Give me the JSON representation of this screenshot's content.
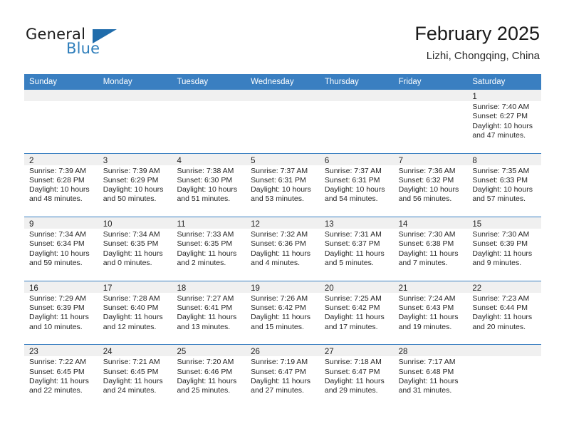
{
  "brand": {
    "name_top": "General",
    "name_bottom": "Blue",
    "flag_icon": "triangle-flag-icon",
    "accent_color": "#2e7ebb"
  },
  "header": {
    "title": "February 2025",
    "subtitle": "Lizhi, Chongqing, China"
  },
  "calendar": {
    "header_bg": "#3a7fc1",
    "header_text_color": "#ffffff",
    "datebar_bg": "#f0f0f0",
    "weekdays": [
      "Sunday",
      "Monday",
      "Tuesday",
      "Wednesday",
      "Thursday",
      "Friday",
      "Saturday"
    ],
    "weeks": [
      [
        {
          "date": "",
          "empty": true
        },
        {
          "date": "",
          "empty": true
        },
        {
          "date": "",
          "empty": true
        },
        {
          "date": "",
          "empty": true
        },
        {
          "date": "",
          "empty": true
        },
        {
          "date": "",
          "empty": true
        },
        {
          "date": "1",
          "sunrise": "Sunrise: 7:40 AM",
          "sunset": "Sunset: 6:27 PM",
          "daylight": "Daylight: 10 hours and 47 minutes."
        }
      ],
      [
        {
          "date": "2",
          "sunrise": "Sunrise: 7:39 AM",
          "sunset": "Sunset: 6:28 PM",
          "daylight": "Daylight: 10 hours and 48 minutes."
        },
        {
          "date": "3",
          "sunrise": "Sunrise: 7:39 AM",
          "sunset": "Sunset: 6:29 PM",
          "daylight": "Daylight: 10 hours and 50 minutes."
        },
        {
          "date": "4",
          "sunrise": "Sunrise: 7:38 AM",
          "sunset": "Sunset: 6:30 PM",
          "daylight": "Daylight: 10 hours and 51 minutes."
        },
        {
          "date": "5",
          "sunrise": "Sunrise: 7:37 AM",
          "sunset": "Sunset: 6:31 PM",
          "daylight": "Daylight: 10 hours and 53 minutes."
        },
        {
          "date": "6",
          "sunrise": "Sunrise: 7:37 AM",
          "sunset": "Sunset: 6:31 PM",
          "daylight": "Daylight: 10 hours and 54 minutes."
        },
        {
          "date": "7",
          "sunrise": "Sunrise: 7:36 AM",
          "sunset": "Sunset: 6:32 PM",
          "daylight": "Daylight: 10 hours and 56 minutes."
        },
        {
          "date": "8",
          "sunrise": "Sunrise: 7:35 AM",
          "sunset": "Sunset: 6:33 PM",
          "daylight": "Daylight: 10 hours and 57 minutes."
        }
      ],
      [
        {
          "date": "9",
          "sunrise": "Sunrise: 7:34 AM",
          "sunset": "Sunset: 6:34 PM",
          "daylight": "Daylight: 10 hours and 59 minutes."
        },
        {
          "date": "10",
          "sunrise": "Sunrise: 7:34 AM",
          "sunset": "Sunset: 6:35 PM",
          "daylight": "Daylight: 11 hours and 0 minutes."
        },
        {
          "date": "11",
          "sunrise": "Sunrise: 7:33 AM",
          "sunset": "Sunset: 6:35 PM",
          "daylight": "Daylight: 11 hours and 2 minutes."
        },
        {
          "date": "12",
          "sunrise": "Sunrise: 7:32 AM",
          "sunset": "Sunset: 6:36 PM",
          "daylight": "Daylight: 11 hours and 4 minutes."
        },
        {
          "date": "13",
          "sunrise": "Sunrise: 7:31 AM",
          "sunset": "Sunset: 6:37 PM",
          "daylight": "Daylight: 11 hours and 5 minutes."
        },
        {
          "date": "14",
          "sunrise": "Sunrise: 7:30 AM",
          "sunset": "Sunset: 6:38 PM",
          "daylight": "Daylight: 11 hours and 7 minutes."
        },
        {
          "date": "15",
          "sunrise": "Sunrise: 7:30 AM",
          "sunset": "Sunset: 6:39 PM",
          "daylight": "Daylight: 11 hours and 9 minutes."
        }
      ],
      [
        {
          "date": "16",
          "sunrise": "Sunrise: 7:29 AM",
          "sunset": "Sunset: 6:39 PM",
          "daylight": "Daylight: 11 hours and 10 minutes."
        },
        {
          "date": "17",
          "sunrise": "Sunrise: 7:28 AM",
          "sunset": "Sunset: 6:40 PM",
          "daylight": "Daylight: 11 hours and 12 minutes."
        },
        {
          "date": "18",
          "sunrise": "Sunrise: 7:27 AM",
          "sunset": "Sunset: 6:41 PM",
          "daylight": "Daylight: 11 hours and 13 minutes."
        },
        {
          "date": "19",
          "sunrise": "Sunrise: 7:26 AM",
          "sunset": "Sunset: 6:42 PM",
          "daylight": "Daylight: 11 hours and 15 minutes."
        },
        {
          "date": "20",
          "sunrise": "Sunrise: 7:25 AM",
          "sunset": "Sunset: 6:42 PM",
          "daylight": "Daylight: 11 hours and 17 minutes."
        },
        {
          "date": "21",
          "sunrise": "Sunrise: 7:24 AM",
          "sunset": "Sunset: 6:43 PM",
          "daylight": "Daylight: 11 hours and 19 minutes."
        },
        {
          "date": "22",
          "sunrise": "Sunrise: 7:23 AM",
          "sunset": "Sunset: 6:44 PM",
          "daylight": "Daylight: 11 hours and 20 minutes."
        }
      ],
      [
        {
          "date": "23",
          "sunrise": "Sunrise: 7:22 AM",
          "sunset": "Sunset: 6:45 PM",
          "daylight": "Daylight: 11 hours and 22 minutes."
        },
        {
          "date": "24",
          "sunrise": "Sunrise: 7:21 AM",
          "sunset": "Sunset: 6:45 PM",
          "daylight": "Daylight: 11 hours and 24 minutes."
        },
        {
          "date": "25",
          "sunrise": "Sunrise: 7:20 AM",
          "sunset": "Sunset: 6:46 PM",
          "daylight": "Daylight: 11 hours and 25 minutes."
        },
        {
          "date": "26",
          "sunrise": "Sunrise: 7:19 AM",
          "sunset": "Sunset: 6:47 PM",
          "daylight": "Daylight: 11 hours and 27 minutes."
        },
        {
          "date": "27",
          "sunrise": "Sunrise: 7:18 AM",
          "sunset": "Sunset: 6:47 PM",
          "daylight": "Daylight: 11 hours and 29 minutes."
        },
        {
          "date": "28",
          "sunrise": "Sunrise: 7:17 AM",
          "sunset": "Sunset: 6:48 PM",
          "daylight": "Daylight: 11 hours and 31 minutes."
        },
        {
          "date": "",
          "empty": true
        }
      ]
    ]
  }
}
